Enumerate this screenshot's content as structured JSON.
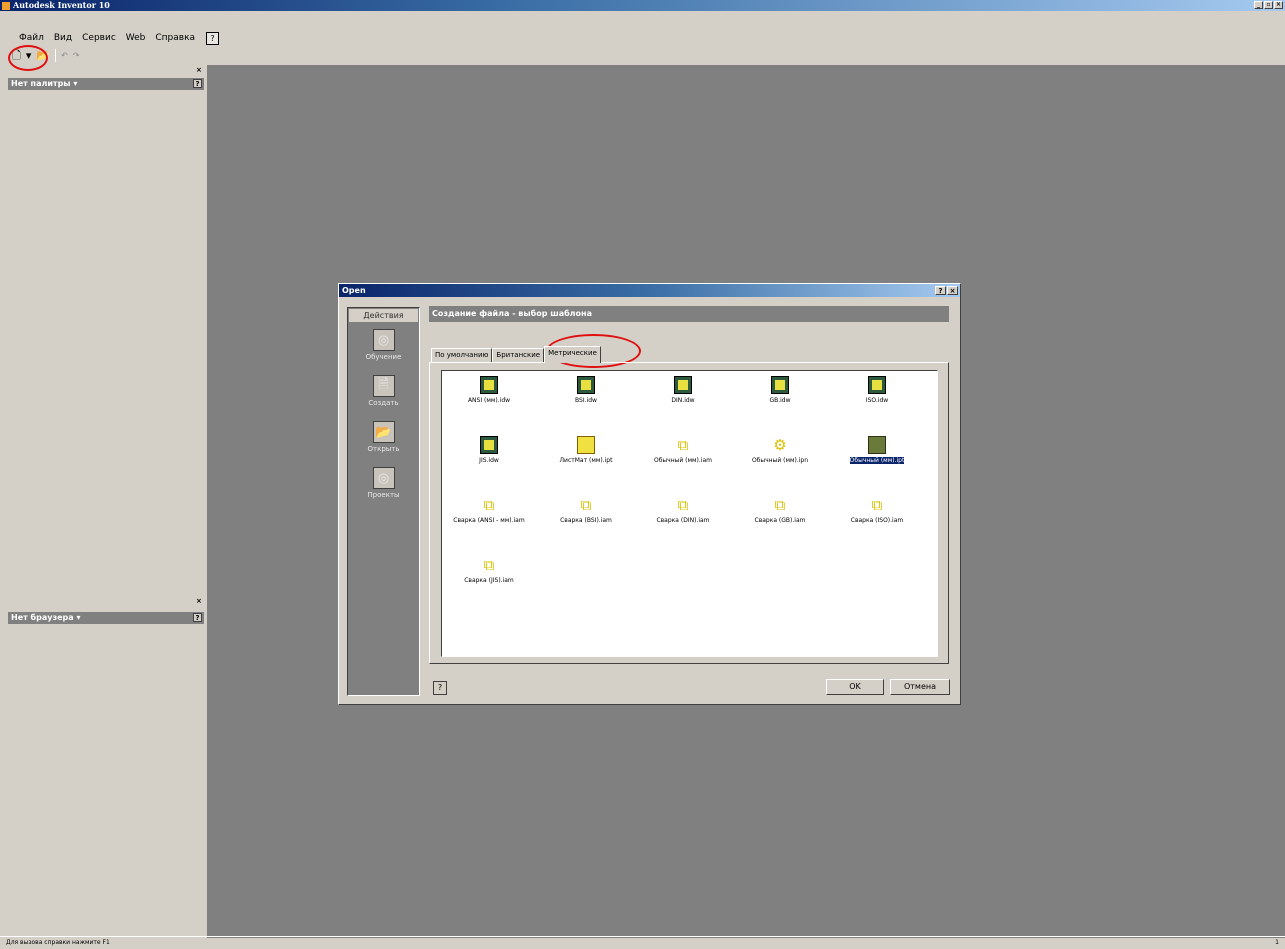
{
  "window": {
    "title": "Autodesk Inventor 10",
    "min": "_",
    "max": "▫",
    "close": "×"
  },
  "menu": [
    "Файл",
    "Вид",
    "Сервис",
    "Web",
    "Справка"
  ],
  "menu_help": "?",
  "toolbar": {
    "new": "🗋",
    "dropdown": "▾",
    "open": "📂",
    "undo": "↶",
    "redo": "↷"
  },
  "palette_panel": {
    "title": "Нет палитры ▾",
    "help": "?",
    "close": "×"
  },
  "browser_panel": {
    "title": "Нет браузера ▾",
    "help": "?",
    "close": "×"
  },
  "status": {
    "text": "Для вызова справки нажмите F1",
    "right": "1"
  },
  "dialog": {
    "title": "Open",
    "help": "?",
    "close": "×",
    "actions_header": "Действия",
    "actions": [
      {
        "label": "Обучение",
        "icon": "◎"
      },
      {
        "label": "Создать",
        "icon": "🗎"
      },
      {
        "label": "Открыть",
        "icon": "📂"
      },
      {
        "label": "Проекты",
        "icon": "◎"
      }
    ],
    "section_title": "Создание файла - выбор шаблона",
    "tabs": [
      "По умолчанию",
      "Британские",
      "Метрические"
    ],
    "active_tab": 2,
    "files": [
      {
        "name": "ANSI (мм).idw",
        "type": "idw"
      },
      {
        "name": "BSI.idw",
        "type": "idw"
      },
      {
        "name": "DIN.idw",
        "type": "idw"
      },
      {
        "name": "GB.idw",
        "type": "idw"
      },
      {
        "name": "ISO.idw",
        "type": "idw"
      },
      {
        "name": "JIS.idw",
        "type": "idw"
      },
      {
        "name": "ЛистМат (мм).ipt",
        "type": "part"
      },
      {
        "name": "Обычный (мм).iam",
        "type": "asm"
      },
      {
        "name": "Обычный (мм).ipn",
        "type": "ipn"
      },
      {
        "name": "Обычный (мм).ipt",
        "type": "part-dark",
        "selected": true
      },
      {
        "name": "Сварка (ANSI - мм).iam",
        "type": "asm"
      },
      {
        "name": "Сварка (BSI).iam",
        "type": "asm"
      },
      {
        "name": "Сварка (DIN).iam",
        "type": "asm"
      },
      {
        "name": "Сварка (GB).iam",
        "type": "asm"
      },
      {
        "name": "Сварка (ISO).iam",
        "type": "asm"
      },
      {
        "name": "Сварка (JIS).iam",
        "type": "asm"
      }
    ],
    "ok": "OK",
    "cancel": "Отмена"
  },
  "colors": {
    "workspace": "#808080",
    "face": "#d4d0c8",
    "title_active": "#0a246a",
    "annotation": "#e01010",
    "selection": "#0a246a"
  }
}
